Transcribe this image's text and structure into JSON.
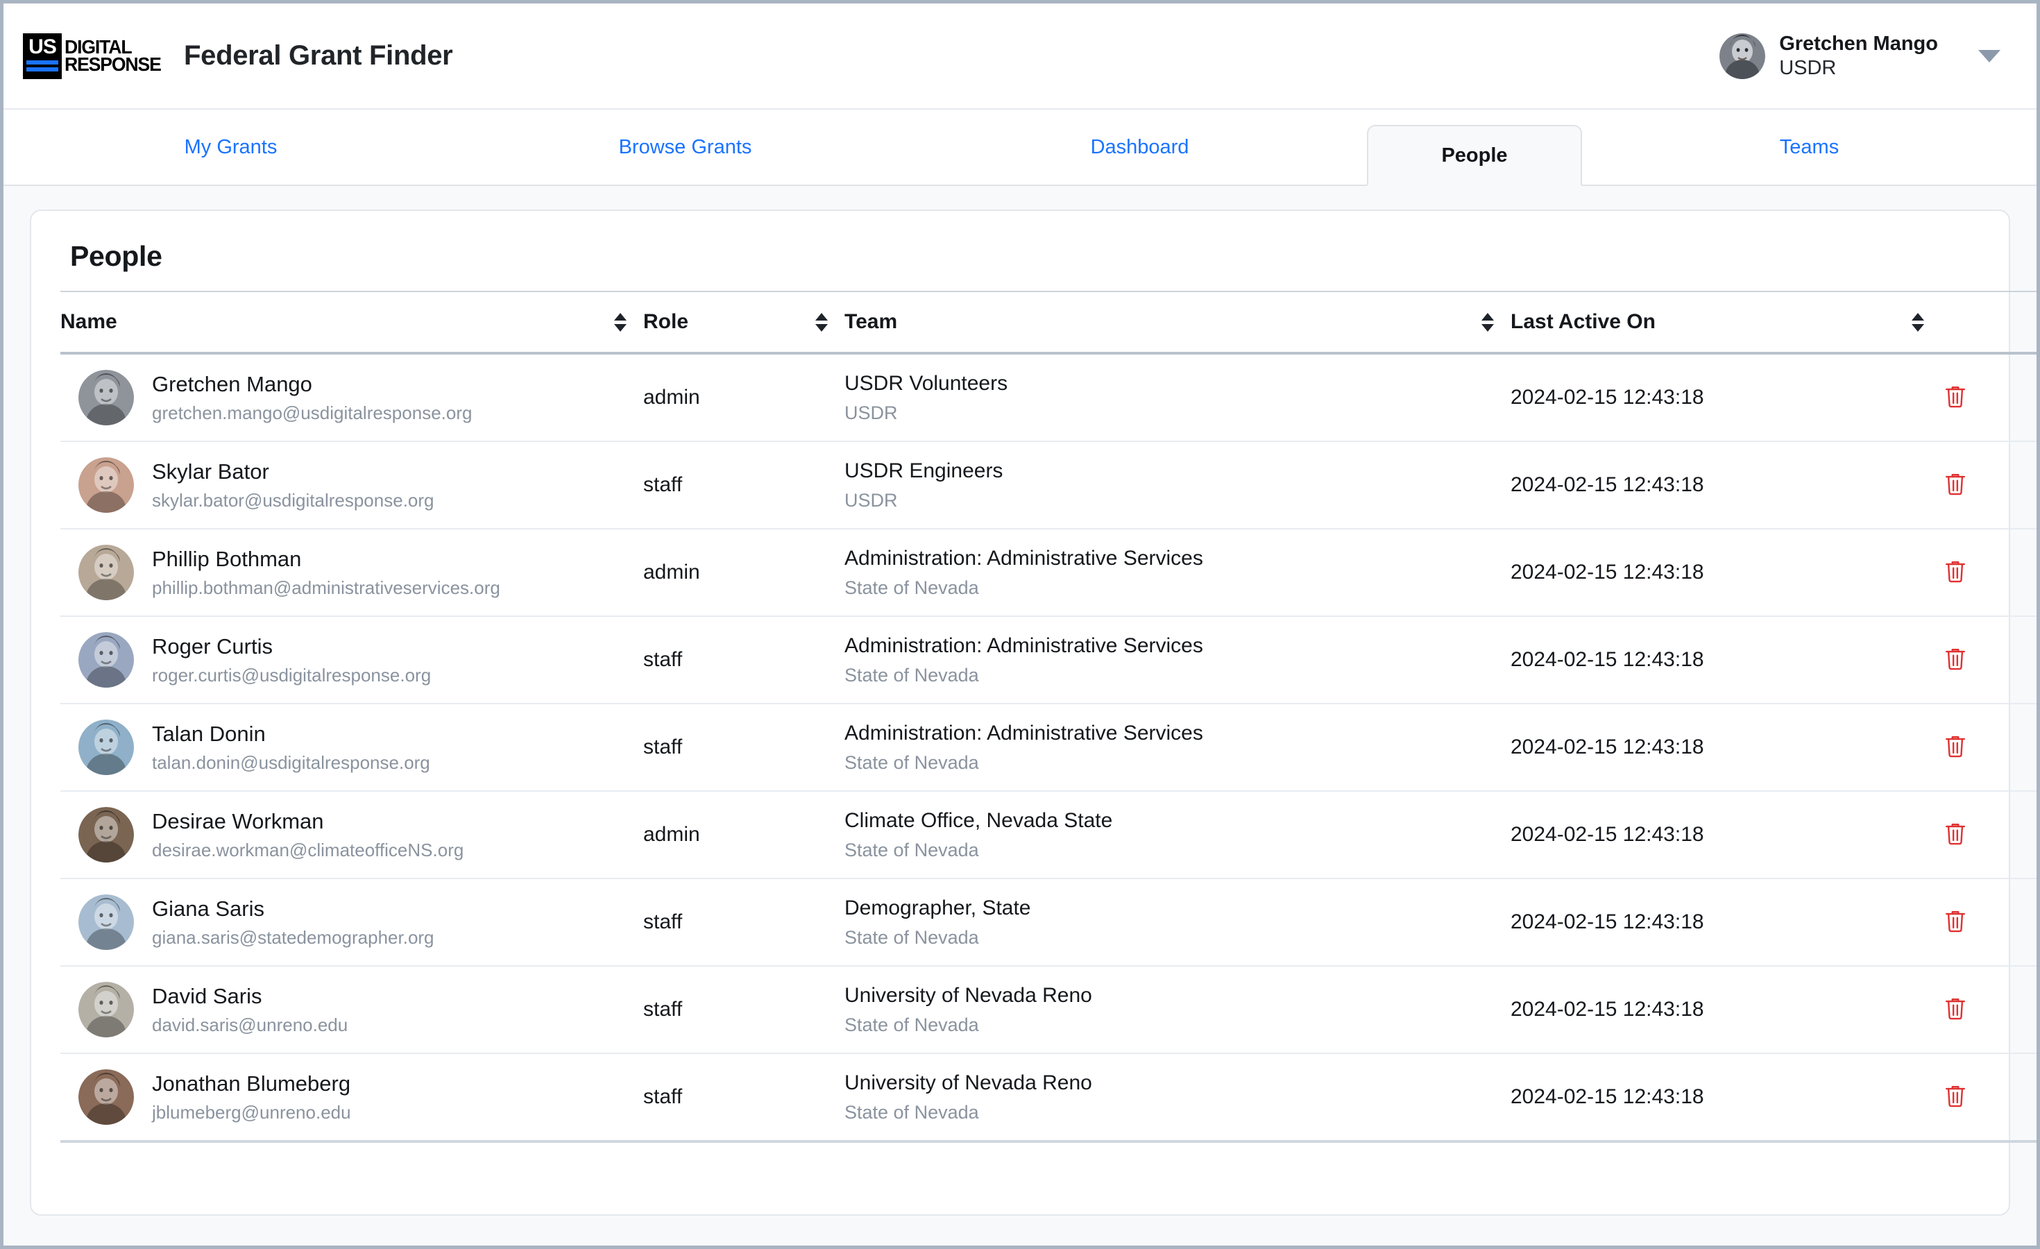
{
  "header": {
    "logo": {
      "mark_text": "US",
      "word_line1": "DIGITAL",
      "word_line2": "RESPONSE",
      "accent_color": "#1a73ff"
    },
    "app_title": "Federal Grant Finder",
    "user": {
      "name": "Gretchen Mango",
      "org": "USDR",
      "avatar_icon": "user-avatar",
      "dropdown_icon": "caret-down-icon"
    }
  },
  "tabs": [
    {
      "label": "My Grants",
      "active": false
    },
    {
      "label": "Browse Grants",
      "active": false
    },
    {
      "label": "Dashboard",
      "active": false
    },
    {
      "label": "People",
      "active": true
    },
    {
      "label": "Teams",
      "active": false
    }
  ],
  "page": {
    "title": "People",
    "table": {
      "columns": [
        {
          "key": "name",
          "label": "Name",
          "sortable": true
        },
        {
          "key": "role",
          "label": "Role",
          "sortable": true
        },
        {
          "key": "team",
          "label": "Team",
          "sortable": true
        },
        {
          "key": "last",
          "label": "Last Active On",
          "sortable": true
        },
        {
          "key": "act",
          "label": "",
          "sortable": false
        }
      ],
      "sort_icon": "sort-updown-icon",
      "delete_icon": "trash-icon",
      "delete_icon_color": "#e03131",
      "rows": [
        {
          "name": "Gretchen Mango",
          "email": "gretchen.mango@usdigitalresponse.org",
          "role": "admin",
          "team": "USDR Volunteers",
          "team_org": "USDR",
          "last_active": "2024-02-15 12:43:18",
          "avatar_tone": "#8f949b"
        },
        {
          "name": "Skylar Bator",
          "email": "skylar.bator@usdigitalresponse.org",
          "role": "staff",
          "team": "USDR Engineers",
          "team_org": "USDR",
          "last_active": "2024-02-15 12:43:18",
          "avatar_tone": "#c9a18f"
        },
        {
          "name": "Phillip Bothman",
          "email": "phillip.bothman@administrativeservices.org",
          "role": "admin",
          "team": "Administration: Administrative Services",
          "team_org": "State of Nevada",
          "last_active": "2024-02-15 12:43:18",
          "avatar_tone": "#b8a897"
        },
        {
          "name": "Roger Curtis",
          "email": "roger.curtis@usdigitalresponse.org",
          "role": "staff",
          "team": "Administration: Administrative Services",
          "team_org": "State of Nevada",
          "last_active": "2024-02-15 12:43:18",
          "avatar_tone": "#9aa7c0"
        },
        {
          "name": "Talan Donin",
          "email": "talan.donin@usdigitalresponse.org",
          "role": "staff",
          "team": "Administration: Administrative Services",
          "team_org": "State of Nevada",
          "last_active": "2024-02-15 12:43:18",
          "avatar_tone": "#8fb0c8"
        },
        {
          "name": "Desirae Workman",
          "email": "desirae.workman@climateofficeNS.org",
          "role": "admin",
          "team": "Climate Office, Nevada State",
          "team_org": "State of Nevada",
          "last_active": "2024-02-15 12:43:18",
          "avatar_tone": "#7a6552"
        },
        {
          "name": "Giana Saris",
          "email": "giana.saris@statedemographer.org",
          "role": "staff",
          "team": "Demographer, State",
          "team_org": "State of Nevada",
          "last_active": "2024-02-15 12:43:18",
          "avatar_tone": "#a7bcd0"
        },
        {
          "name": "David Saris",
          "email": "david.saris@unreno.edu",
          "role": "staff",
          "team": "University of Nevada Reno",
          "team_org": "State of Nevada",
          "last_active": "2024-02-15 12:43:18",
          "avatar_tone": "#b4b0a6"
        },
        {
          "name": "Jonathan Blumeberg",
          "email": "jblumeberg@unreno.edu",
          "role": "staff",
          "team": "University of Nevada Reno",
          "team_org": "State of Nevada",
          "last_active": "2024-02-15 12:43:18",
          "avatar_tone": "#8a6a58"
        }
      ]
    }
  }
}
